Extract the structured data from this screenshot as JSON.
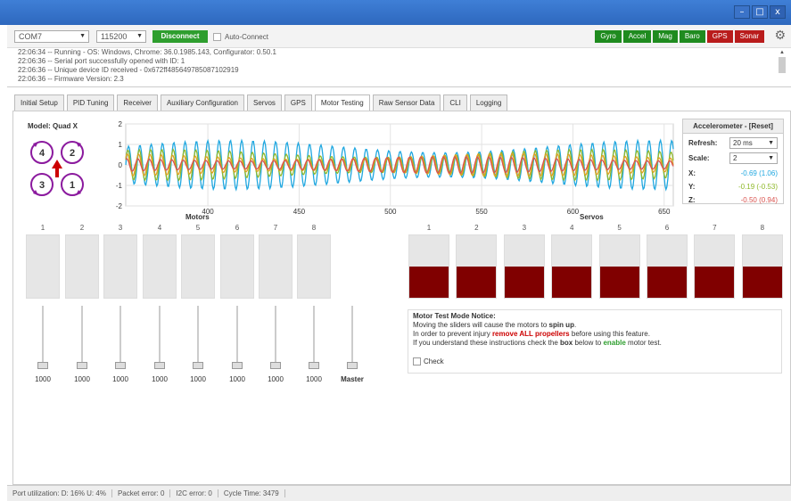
{
  "window": {
    "minimize": "–",
    "maximize": "□",
    "close": "x"
  },
  "toolbar": {
    "port": "COM7",
    "baud": "115200",
    "connect_label": "Disconnect",
    "auto_connect_label": "Auto-Connect",
    "sensors": [
      {
        "label": "Gyro",
        "state": "on"
      },
      {
        "label": "Accel",
        "state": "on"
      },
      {
        "label": "Mag",
        "state": "on"
      },
      {
        "label": "Baro",
        "state": "on"
      },
      {
        "label": "GPS",
        "state": "off"
      },
      {
        "label": "Sonar",
        "state": "off"
      }
    ],
    "colors": {
      "on": "#1f8b1f",
      "off": "#b91c1c",
      "connect": "#2e9e2e"
    }
  },
  "log": {
    "lines": [
      {
        "time": "22:06:34",
        "text": "Running - OS: Windows, Chrome: 36.0.1985.143, Configurator: 0.50.1"
      },
      {
        "time": "22:06:36",
        "text": "Serial port successfully opened with ID: 1"
      },
      {
        "time": "22:06:36",
        "text": "Unique device ID received - 0x672ff485649785087102919"
      },
      {
        "time": "22:06:36",
        "text": "Firmware Version: 2.3"
      }
    ]
  },
  "tabs": [
    {
      "label": "Initial Setup"
    },
    {
      "label": "PID Tuning"
    },
    {
      "label": "Receiver"
    },
    {
      "label": "Auxiliary Configuration"
    },
    {
      "label": "Servos"
    },
    {
      "label": "GPS"
    },
    {
      "label": "Motor Testing",
      "active": true
    },
    {
      "label": "Raw Sensor Data"
    },
    {
      "label": "CLI"
    },
    {
      "label": "Logging"
    }
  ],
  "model": {
    "title": "Model: Quad X",
    "rotors": [
      "4",
      "2",
      "3",
      "1"
    ],
    "color": "#8b1a9e",
    "arrow_color": "#cc0000"
  },
  "chart_data": {
    "type": "line",
    "x_range": [
      355,
      655
    ],
    "x_ticks": [
      400,
      450,
      500,
      550,
      600,
      650
    ],
    "ylim": [
      -2,
      2
    ],
    "y_ticks": [
      2,
      1,
      0,
      -1,
      -2
    ],
    "grid": true,
    "series": [
      {
        "color": "#1fa7e0",
        "amplitude": 1.2,
        "period": 6.2
      },
      {
        "color": "#8fb92b",
        "amplitude": 0.75,
        "period": 6.2
      },
      {
        "color": "#e0a020",
        "amplitude": 0.55,
        "period": 6.2
      },
      {
        "color": "#d9534f",
        "amplitude": 0.4,
        "period": 6.2
      }
    ]
  },
  "accel": {
    "title": "Accelerometer - [Reset]",
    "refresh_label": "Refresh:",
    "refresh_value": "20 ms",
    "scale_label": "Scale:",
    "scale_value": "2",
    "x_label": "X:",
    "x_value": "-0.69 (1.06)",
    "y_label": "Y:",
    "y_value": "-0.19 (-0.53)",
    "z_label": "Z:",
    "z_value": "-0.50 (0.94)",
    "colors": {
      "x": "#1fa7e0",
      "y": "#8fb92b",
      "z": "#d9534f"
    }
  },
  "motors": {
    "title": "Motors",
    "numbers": [
      "1",
      "2",
      "3",
      "4",
      "5",
      "6",
      "7",
      "8"
    ],
    "values": [
      "1000",
      "1000",
      "1000",
      "1000",
      "1000",
      "1000",
      "1000",
      "1000"
    ],
    "master_label": "Master"
  },
  "servos": {
    "title": "Servos",
    "numbers": [
      "1",
      "2",
      "3",
      "4",
      "5",
      "6",
      "7",
      "8"
    ],
    "fill_fraction": [
      0.5,
      0.5,
      0.5,
      0.5,
      0.5,
      0.5,
      0.5,
      0.5
    ],
    "fill_color": "#800000"
  },
  "notice": {
    "title": "Motor Test Mode Notice:",
    "line1_a": "Moving the sliders will cause the motors to ",
    "line1_b": "spin up",
    "line1_c": ".",
    "line2_a": "In order to prevent injury ",
    "line2_b": "remove ALL propellers",
    "line2_c": " before using this feature.",
    "line3_a": "If you understand these instructions check the ",
    "line3_b": "box",
    "line3_c": " below to ",
    "line3_d": "enable",
    "line3_e": " motor test.",
    "check_label": "Check"
  },
  "status": {
    "port_util": "Port utilization: D: 16% U: 4%",
    "packet_error": "Packet error: 0",
    "i2c_error": "I2C error: 0",
    "cycle_time": "Cycle Time: 3479"
  }
}
